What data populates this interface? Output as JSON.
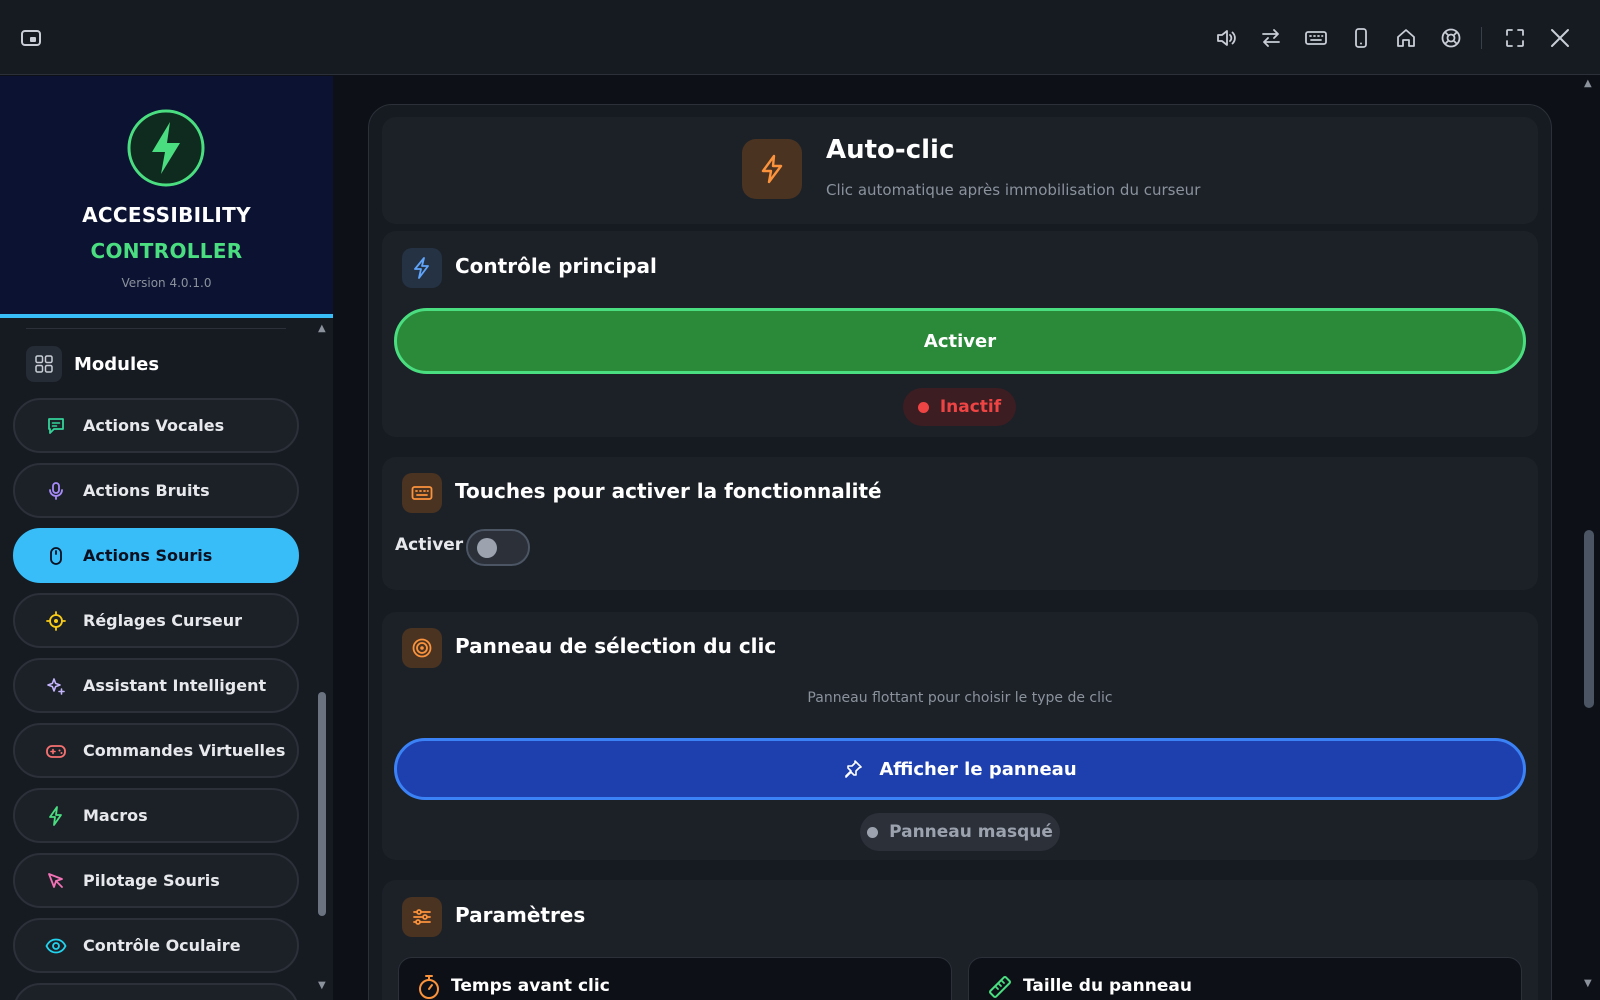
{
  "titlebar": {
    "left_icon": "picture-in-picture-icon",
    "icons": [
      "volume-icon",
      "swap-icon",
      "keyboard-icon",
      "phone-icon",
      "home-icon",
      "lifebuoy-icon",
      "fullscreen-icon",
      "close-icon"
    ]
  },
  "brand": {
    "logo_icon": "lightning-icon",
    "line1": "ACCESSIBILITY",
    "line2": "CONTROLLER",
    "version": "Version 4.0.1.0"
  },
  "sidebar": {
    "section_label": "Modules",
    "items": [
      {
        "label": "Actions Vocales",
        "icon": "chat-icon",
        "color": "#34d399",
        "active": false
      },
      {
        "label": "Actions Bruits",
        "icon": "microphone-icon",
        "color": "#a78bfa",
        "active": false
      },
      {
        "label": "Actions Souris",
        "icon": "mouse-icon",
        "color": "#0b1020",
        "active": true
      },
      {
        "label": "Réglages Curseur",
        "icon": "crosshair-icon",
        "color": "#facc15",
        "active": false
      },
      {
        "label": "Assistant Intelligent",
        "icon": "sparkles-icon",
        "color": "#c4b5fd",
        "active": false
      },
      {
        "label": "Commandes Virtuelles",
        "icon": "gamepad-icon",
        "color": "#f87171",
        "active": false
      },
      {
        "label": "Macros",
        "icon": "lightning-icon",
        "color": "#4ade80",
        "active": false
      },
      {
        "label": "Pilotage Souris",
        "icon": "cursor-icon",
        "color": "#f472b6",
        "active": false
      },
      {
        "label": "Contrôle Oculaire",
        "icon": "eye-icon",
        "color": "#22d3ee",
        "active": false
      }
    ]
  },
  "header": {
    "title": "Auto-clic",
    "subtitle": "Clic automatique après immobilisation du curseur",
    "accent": "#fb923c"
  },
  "main_control": {
    "title": "Contrôle principal",
    "button_label": "Activer",
    "status": "Inactif",
    "status_color": "#ef4444"
  },
  "keys": {
    "title": "Touches pour activer la fonctionnalité",
    "toggle_label": "Activer",
    "toggle_on": false
  },
  "panel_selection": {
    "title": "Panneau de sélection du clic",
    "description": "Panneau flottant pour choisir le type de clic",
    "button_label": "Afficher le panneau",
    "status": "Panneau masqué"
  },
  "parameters": {
    "title": "Paramètres",
    "cards": [
      {
        "label": "Temps avant clic",
        "icon": "stopwatch-icon"
      },
      {
        "label": "Taille du panneau",
        "icon": "ruler-icon"
      }
    ]
  }
}
